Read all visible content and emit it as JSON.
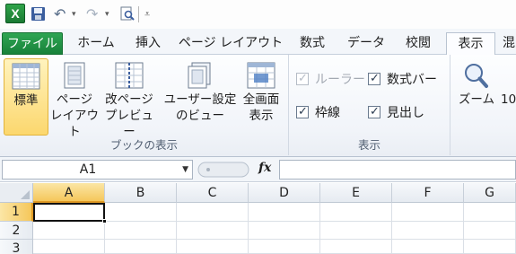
{
  "app": {
    "logo_letter": "X",
    "qat": [
      "save-icon",
      "undo-icon",
      "redo-icon",
      "print-preview-icon",
      "customize-qat-icon"
    ]
  },
  "tabs": [
    {
      "label": "ファイル"
    },
    {
      "label": "ホーム"
    },
    {
      "label": "挿入"
    },
    {
      "label": "ページ レイアウト"
    },
    {
      "label": "数式"
    },
    {
      "label": "データ"
    },
    {
      "label": "校閲"
    },
    {
      "label": "表示"
    },
    {
      "label": "混"
    }
  ],
  "active_tab": "表示",
  "ribbon": {
    "workbook_views": {
      "group_label": "ブックの表示",
      "normal": "標準",
      "page_layout_1": "ページ",
      "page_layout_2": "レイアウト",
      "page_break_1": "改ページ",
      "page_break_2": "プレビュー",
      "custom_views_1": "ユーザー設定",
      "custom_views_2": "のビュー",
      "full_screen_1": "全画面",
      "full_screen_2": "表示"
    },
    "show": {
      "group_label": "表示",
      "ruler": {
        "label": "ルーラー",
        "checked": true,
        "disabled": true
      },
      "formula_bar": {
        "label": "数式バー",
        "checked": true
      },
      "gridlines": {
        "label": "枠線",
        "checked": true
      },
      "headings": {
        "label": "見出し",
        "checked": true
      }
    },
    "zoom": {
      "zoom_label": "ズーム",
      "hundred_label": "10"
    }
  },
  "formula_bar": {
    "name_box": "A1",
    "fx": "fx",
    "value": ""
  },
  "sheet": {
    "columns": [
      "A",
      "B",
      "C",
      "D",
      "E",
      "F",
      "G"
    ],
    "rows": [
      "1",
      "2",
      "3"
    ],
    "selected_cell": "A1"
  },
  "colors": {
    "file_tab": "#1f8f43",
    "selected_header": "#f5c75b",
    "pressed_button": "#fcd76e"
  }
}
